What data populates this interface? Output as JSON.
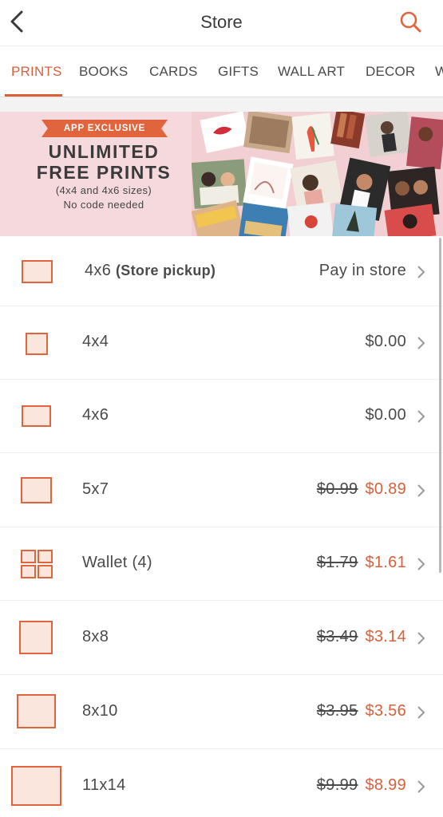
{
  "header": {
    "title": "Store"
  },
  "tabs": [
    {
      "label": "PRINTS",
      "active": true
    },
    {
      "label": "BOOKS"
    },
    {
      "label": "CARDS"
    },
    {
      "label": "GIFTS"
    },
    {
      "label": "WALL ART"
    },
    {
      "label": "DECOR"
    },
    {
      "label": "W"
    }
  ],
  "banner": {
    "badge": "APP EXCLUSIVE",
    "headline_1": "UNLIMITED",
    "headline_2": "FREE PRINTS",
    "sub_1": "(4x4 and 4x6 sizes)",
    "sub_2": "No code needed"
  },
  "products": [
    {
      "size": "4x6",
      "note": "(Store pickup)",
      "price": "Pay in store"
    },
    {
      "size": "4x4",
      "price": "$0.00"
    },
    {
      "size": "4x6",
      "price": "$0.00"
    },
    {
      "size": "5x7",
      "old_price": "$0.99",
      "price": "$0.89"
    },
    {
      "size": "Wallet (4)",
      "old_price": "$1.79",
      "price": "$1.61"
    },
    {
      "size": "8x8",
      "old_price": "$3.49",
      "price": "$3.14"
    },
    {
      "size": "8x10",
      "old_price": "$3.95",
      "price": "$3.56"
    },
    {
      "size": "11x14",
      "old_price": "$9.99",
      "price": "$8.99"
    }
  ],
  "colors": {
    "accent": "#d9603a",
    "banner_bg": "#f5d9dc",
    "thumb_fill": "#fbe6dd"
  }
}
